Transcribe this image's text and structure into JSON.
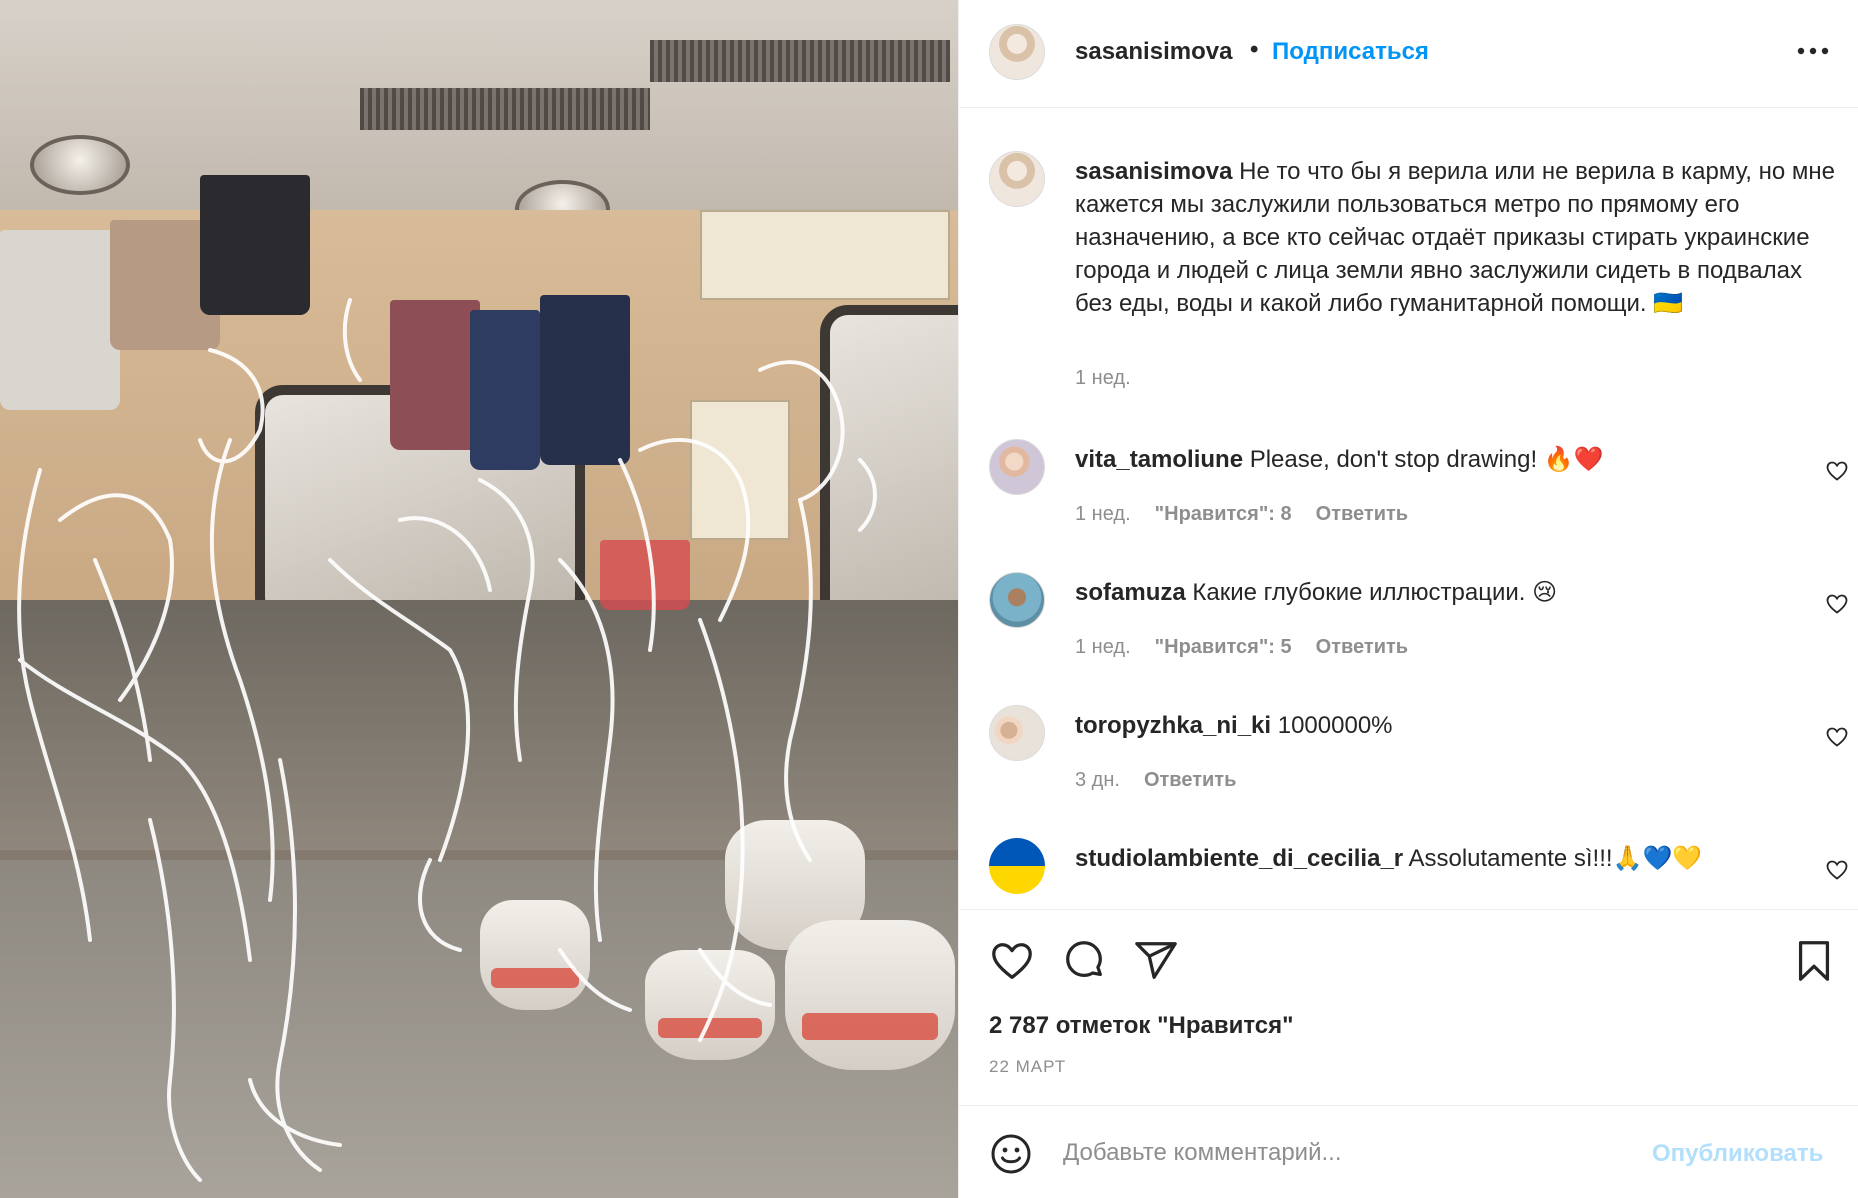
{
  "post_author": {
    "username": "sasanisimova",
    "separator": "•",
    "follow_label": "Подписаться"
  },
  "caption": {
    "username": "sasanisimova",
    "text": "Не то что бы я верила или не верила в карму, но мне кажется мы заслужили пользоваться метро по прямому его назначению, а все кто сейчас отдаёт приказы стирать украинские города и людей с лица земли явно заслужили сидеть в подвалах без еды, воды и какой либо гуманитарной помощи. 🇺🇦",
    "time": "1 нед."
  },
  "comments": [
    {
      "username": "vita_tamoliune",
      "text": "Please, don't stop drawing! 🔥❤️",
      "time": "1 нед.",
      "likes": "\"Нравится\": 8",
      "reply": "Ответить"
    },
    {
      "username": "sofamuza",
      "text": "Какие глубокие иллюстрации. 😢",
      "time": "1 нед.",
      "likes": "\"Нравится\": 5",
      "reply": "Ответить"
    },
    {
      "username": "toropyzhka_ni_ki",
      "text": "1000000%",
      "time": "3 дн.",
      "likes": "",
      "reply": "Ответить"
    },
    {
      "username": "studiolambiente_di_cecilia_r",
      "text": "Assolutamente sì!!!🙏💙💛",
      "time": "",
      "likes": "",
      "reply": ""
    }
  ],
  "actions": {
    "likes_count": "2 787 отметок \"Нравится\"",
    "date": "22 МАРТ"
  },
  "add_comment": {
    "placeholder": "Добавьте комментарий...",
    "publish_label": "Опубликовать"
  },
  "icons": {
    "more": "more-horizontal-icon",
    "like": "heart-icon",
    "comment": "comment-icon",
    "share": "paper-plane-icon",
    "save": "bookmark-icon",
    "emoji": "smiley-icon"
  },
  "colors": {
    "link_blue": "#0095f6",
    "publish_disabled": "#b2dffc",
    "secondary_text": "#8e8e8e",
    "primary_text": "#262626"
  }
}
